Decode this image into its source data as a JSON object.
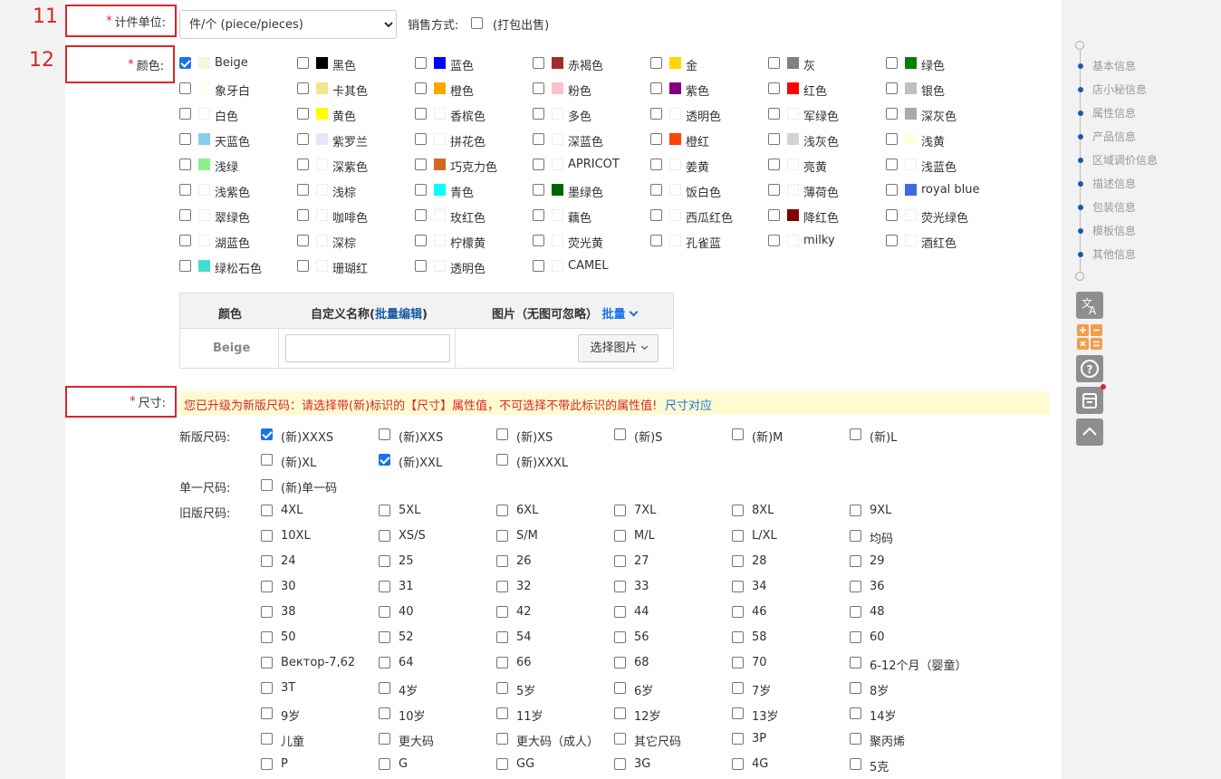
{
  "annotations": {
    "n11": "11",
    "n12": "12"
  },
  "unit": {
    "label": "计件单位:",
    "select_value": "件/个 (piece/pieces)",
    "sale_label": "销售方式:",
    "sale_option": "(打包出售)"
  },
  "color": {
    "label": "颜色:",
    "options": [
      {
        "label": "Beige",
        "swatch": "#f5f5dc",
        "checked": true
      },
      {
        "label": "黑色",
        "swatch": "#000000",
        "checked": false
      },
      {
        "label": "蓝色",
        "swatch": "#0000ff",
        "checked": false
      },
      {
        "label": "赤褐色",
        "swatch": "#a52a2a",
        "checked": false
      },
      {
        "label": "金",
        "swatch": "#ffd700",
        "checked": false
      },
      {
        "label": "灰",
        "swatch": "#808080",
        "checked": false
      },
      {
        "label": "绿色",
        "swatch": "#008000",
        "checked": false
      },
      {
        "label": "象牙白",
        "swatch": "#fffff0",
        "checked": false
      },
      {
        "label": "卡其色",
        "swatch": "#f0e68c",
        "checked": false
      },
      {
        "label": "橙色",
        "swatch": "#ffa500",
        "checked": false
      },
      {
        "label": "粉色",
        "swatch": "#ffc0cb",
        "checked": false
      },
      {
        "label": "紫色",
        "swatch": "#800080",
        "checked": false
      },
      {
        "label": "红色",
        "swatch": "#ff0000",
        "checked": false
      },
      {
        "label": "银色",
        "swatch": "#c0c0c0",
        "checked": false
      },
      {
        "label": "白色",
        "swatch": "#ffffff",
        "checked": false
      },
      {
        "label": "黄色",
        "swatch": "#ffff00",
        "checked": false
      },
      {
        "label": "香槟色",
        "swatch": "#ffffff",
        "checked": false
      },
      {
        "label": "多色",
        "swatch": "#ffffff",
        "checked": false
      },
      {
        "label": "透明色",
        "swatch": "#ffffff",
        "checked": false
      },
      {
        "label": "军绿色",
        "swatch": "#ffffff",
        "checked": false
      },
      {
        "label": "深灰色",
        "swatch": "#a9a9a9",
        "checked": false
      },
      {
        "label": "天蓝色",
        "swatch": "#87ceeb",
        "checked": false
      },
      {
        "label": "紫罗兰",
        "swatch": "#e6e6fa",
        "checked": false
      },
      {
        "label": "拼花色",
        "swatch": "#ffffff",
        "checked": false
      },
      {
        "label": "深蓝色",
        "swatch": "#ffffff",
        "checked": false
      },
      {
        "label": "橙红",
        "swatch": "#ff4500",
        "checked": false
      },
      {
        "label": "浅灰色",
        "swatch": "#d3d3d3",
        "checked": false
      },
      {
        "label": "浅黄",
        "swatch": "#ffffe0",
        "checked": false
      },
      {
        "label": "浅绿",
        "swatch": "#90ee90",
        "checked": false
      },
      {
        "label": "深紫色",
        "swatch": "#ffffff",
        "checked": false
      },
      {
        "label": "巧克力色",
        "swatch": "#d2691e",
        "checked": false
      },
      {
        "label": "APRICOT",
        "swatch": "#ffffff",
        "checked": false
      },
      {
        "label": "姜黄",
        "swatch": "#ffffff",
        "checked": false
      },
      {
        "label": "亮黄",
        "swatch": "#ffffff",
        "checked": false
      },
      {
        "label": "浅蓝色",
        "swatch": "#ffffff",
        "checked": false
      },
      {
        "label": "浅紫色",
        "swatch": "#ffffff",
        "checked": false
      },
      {
        "label": "浅棕",
        "swatch": "#ffffff",
        "checked": false
      },
      {
        "label": "青色",
        "swatch": "#00ffff",
        "checked": false
      },
      {
        "label": "墨绿色",
        "swatch": "#006400",
        "checked": false
      },
      {
        "label": "饭白色",
        "swatch": "#ffffff",
        "checked": false
      },
      {
        "label": "薄荷色",
        "swatch": "#ffffff",
        "checked": false
      },
      {
        "label": "royal blue",
        "swatch": "#4169e1",
        "checked": false
      },
      {
        "label": "翠绿色",
        "swatch": "#ffffff",
        "checked": false
      },
      {
        "label": "咖啡色",
        "swatch": "#ffffff",
        "checked": false
      },
      {
        "label": "玫红色",
        "swatch": "#ffffff",
        "checked": false
      },
      {
        "label": "藕色",
        "swatch": "#ffffff",
        "checked": false
      },
      {
        "label": "西瓜红色",
        "swatch": "#ffffff",
        "checked": false
      },
      {
        "label": "降红色",
        "swatch": "#800000",
        "checked": false
      },
      {
        "label": "荧光绿色",
        "swatch": "#ffffff",
        "checked": false
      },
      {
        "label": "湖蓝色",
        "swatch": "#ffffff",
        "checked": false
      },
      {
        "label": "深棕",
        "swatch": "#ffffff",
        "checked": false
      },
      {
        "label": "柠檬黄",
        "swatch": "#ffffff",
        "checked": false
      },
      {
        "label": "荧光黄",
        "swatch": "#ffffff",
        "checked": false
      },
      {
        "label": "孔雀蓝",
        "swatch": "#ffffff",
        "checked": false
      },
      {
        "label": "milky",
        "swatch": "#ffffff",
        "checked": false
      },
      {
        "label": "酒红色",
        "swatch": "#ffffff",
        "checked": false
      },
      {
        "label": "绿松石色",
        "swatch": "#40e0d0",
        "checked": false
      },
      {
        "label": "珊瑚红",
        "swatch": "#ffffff",
        "checked": false
      },
      {
        "label": "透明色",
        "swatch": "#ffffff",
        "checked": false
      },
      {
        "label": "CAMEL",
        "swatch": "#ffffff",
        "checked": false
      }
    ],
    "table": {
      "col_color": "颜色",
      "col_custom_prefix": "自定义名称(",
      "col_custom_link": "批量编辑",
      "col_custom_suffix": ")",
      "col_image": "图片（无图可忽略）",
      "col_image_link": "批量",
      "row_color": "Beige",
      "row_input_value": "",
      "select_image_btn": "选择图片"
    }
  },
  "size": {
    "label": "尺寸:",
    "notice": "您已升级为新版尺码：请选择带(新)标识的【尺寸】属性值，不可选择不带此标识的属性值!",
    "notice_link": "尺寸对应",
    "new_label": "新版尺码:",
    "new_options": [
      {
        "label": "(新)XXXS",
        "checked": true
      },
      {
        "label": "(新)XXS",
        "checked": false
      },
      {
        "label": "(新)XS",
        "checked": false
      },
      {
        "label": "(新)S",
        "checked": false
      },
      {
        "label": "(新)M",
        "checked": false
      },
      {
        "label": "(新)L",
        "checked": false
      },
      {
        "label": "(新)XL",
        "checked": false
      },
      {
        "label": "(新)XXL",
        "checked": true
      },
      {
        "label": "(新)XXXL",
        "checked": false
      }
    ],
    "single_label": "单一尺码:",
    "single_options": [
      {
        "label": "(新)单一码",
        "checked": false
      }
    ],
    "old_label": "旧版尺码:",
    "old_options": [
      "4XL",
      "5XL",
      "6XL",
      "7XL",
      "8XL",
      "9XL",
      "10XL",
      "XS/S",
      "S/M",
      "M/L",
      "L/XL",
      "均码",
      "24",
      "25",
      "26",
      "27",
      "28",
      "29",
      "30",
      "31",
      "32",
      "33",
      "34",
      "36",
      "38",
      "40",
      "42",
      "44",
      "46",
      "48",
      "50",
      "52",
      "54",
      "56",
      "58",
      "60",
      "Вектор-7,62",
      "64",
      "66",
      "68",
      "70",
      "6-12个月（婴童）",
      "3T",
      "4岁",
      "5岁",
      "6岁",
      "7岁",
      "8岁",
      "9岁",
      "10岁",
      "11岁",
      "12岁",
      "13岁",
      "14岁",
      "儿童",
      "更大码",
      "更大码（成人）",
      "其它尺码",
      "3P",
      "聚丙烯",
      "P",
      "G",
      "GG",
      "3G",
      "4G",
      "5克"
    ]
  },
  "nav": {
    "items": [
      "基本信息",
      "店小秘信息",
      "属性信息",
      "产品信息",
      "区域调价信息",
      "描述信息",
      "包装信息",
      "模板信息",
      "其他信息"
    ]
  },
  "tools": [
    "translate-icon",
    "calculator-icon",
    "help-icon",
    "archive-icon",
    "scroll-top-icon"
  ]
}
